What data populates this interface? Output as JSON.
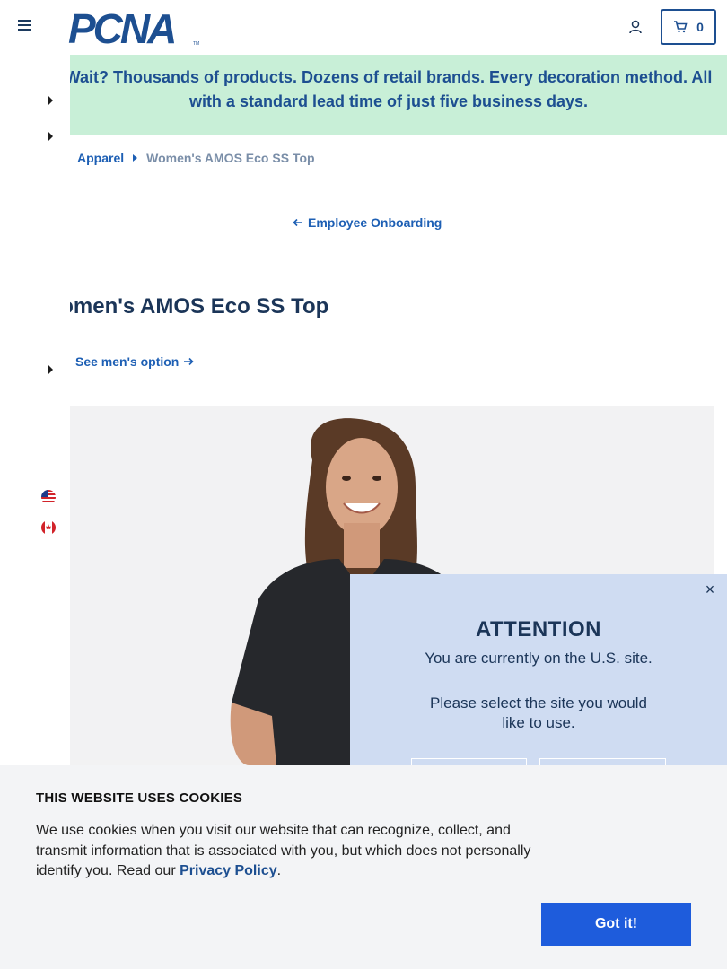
{
  "header": {
    "brand": "PCNA",
    "cart_count": "0"
  },
  "banner": {
    "text": "Wait? Thousands of products. Dozens of retail brands. Every decoration method. All with a standard lead time of just five business days."
  },
  "breadcrumb": {
    "items": [
      "Apparel",
      "Women's AMOS Eco SS Top"
    ]
  },
  "back_link": {
    "label": "Employee Onboarding"
  },
  "product": {
    "title": "Women's AMOS Eco SS Top",
    "mens_option_label": "See men's option"
  },
  "side_rail": {
    "flags": [
      "us-flag-icon",
      "canada-flag-icon"
    ]
  },
  "modal": {
    "close_symbol": "×",
    "title": "ATTENTION",
    "line1": "You are currently on the U.S. site.",
    "line2": "Please select the site you would like to use."
  },
  "cookie": {
    "title": "THIS WEBSITE USES COOKIES",
    "text": "We use cookies when you visit our website that can recognize, collect, and transmit information that is associated with you, but which does not personally identify you. Read our ",
    "link": "Privacy Policy",
    "period": ".",
    "button": "Got it!"
  },
  "colors": {
    "brand_blue": "#1d4f91",
    "link_blue": "#1d5fb4",
    "banner_green": "#c8efd7",
    "modal_bg": "#cfdcf2",
    "cookie_button": "#1e5cdc"
  }
}
